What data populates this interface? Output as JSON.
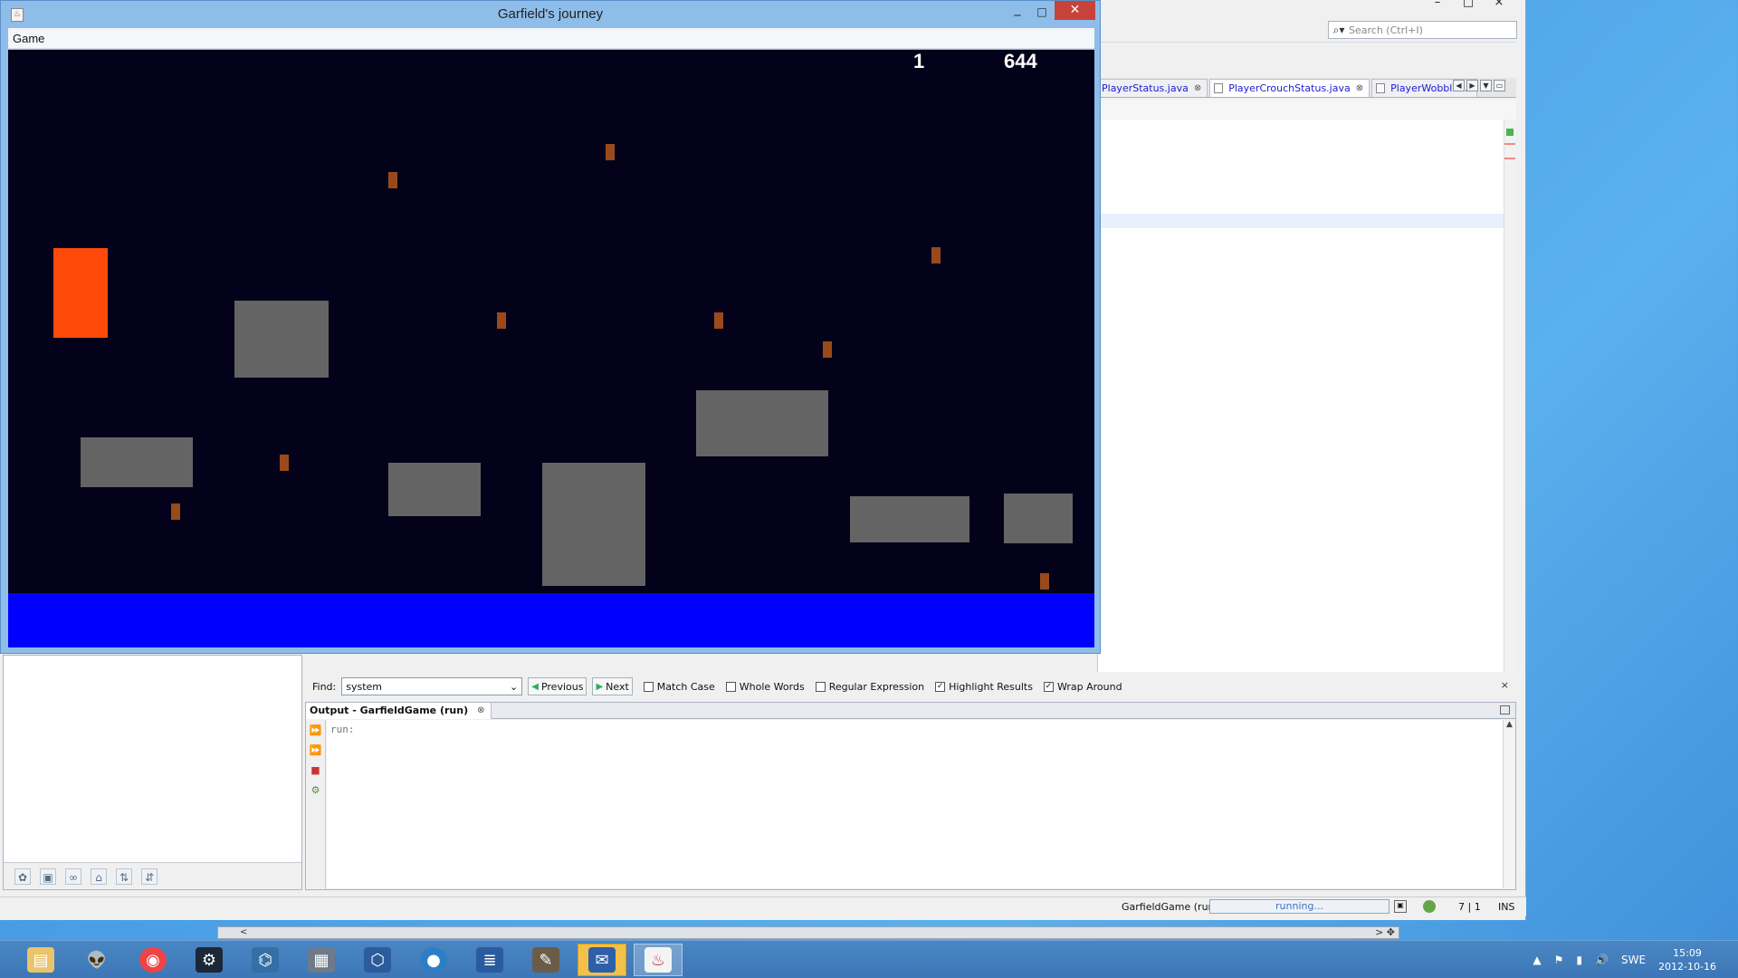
{
  "ide": {
    "search_placeholder": "Search (Ctrl+I)",
    "editor_tabs": [
      {
        "label": "PlayerStatus.java",
        "close": "⊗"
      },
      {
        "label": "PlayerCrouchStatus.java",
        "close": "⊗"
      },
      {
        "label": "PlayerWobble....",
        "close": ""
      }
    ],
    "find": {
      "label": "Find:",
      "value": "system",
      "previous_label": "Previous",
      "next_label": "Next",
      "options": [
        {
          "label": "Match Case",
          "checked": false
        },
        {
          "label": "Whole Words",
          "checked": false
        },
        {
          "label": "Regular Expression",
          "checked": false
        },
        {
          "label": "Highlight Results",
          "checked": true
        },
        {
          "label": "Wrap Around",
          "checked": true
        }
      ],
      "close": "×"
    },
    "output": {
      "tab_label": "Output - GarfieldGame (run)",
      "tab_close": "⊗",
      "text": "run:"
    },
    "status": {
      "process": "GarfieldGame (run)",
      "progress": "running...",
      "position": "7 | 1",
      "mode": "INS"
    }
  },
  "game_window": {
    "title": "Garfield's journey",
    "menu": [
      "Game"
    ],
    "hud": {
      "level": "1",
      "score": "644"
    },
    "colors": {
      "background": "#03021a",
      "platform": "#646464",
      "coin": "#9a4a1a",
      "player": "#ff4a0a",
      "water": "#0000ff"
    }
  },
  "taskbar": {
    "tray": {
      "language": "SWE",
      "time": "15:09",
      "date": "2012-10-16"
    },
    "apps": [
      {
        "icon": "file-explorer-icon"
      },
      {
        "icon": "alien-icon"
      },
      {
        "icon": "chrome-icon"
      },
      {
        "icon": "steam-icon"
      },
      {
        "icon": "python-icon"
      },
      {
        "icon": "bag-icon"
      },
      {
        "icon": "virtualbox-icon"
      },
      {
        "icon": "disk-icon"
      },
      {
        "icon": "document-icon"
      },
      {
        "icon": "gimp-icon"
      },
      {
        "icon": "messenger-icon"
      },
      {
        "icon": "java-icon"
      }
    ]
  }
}
